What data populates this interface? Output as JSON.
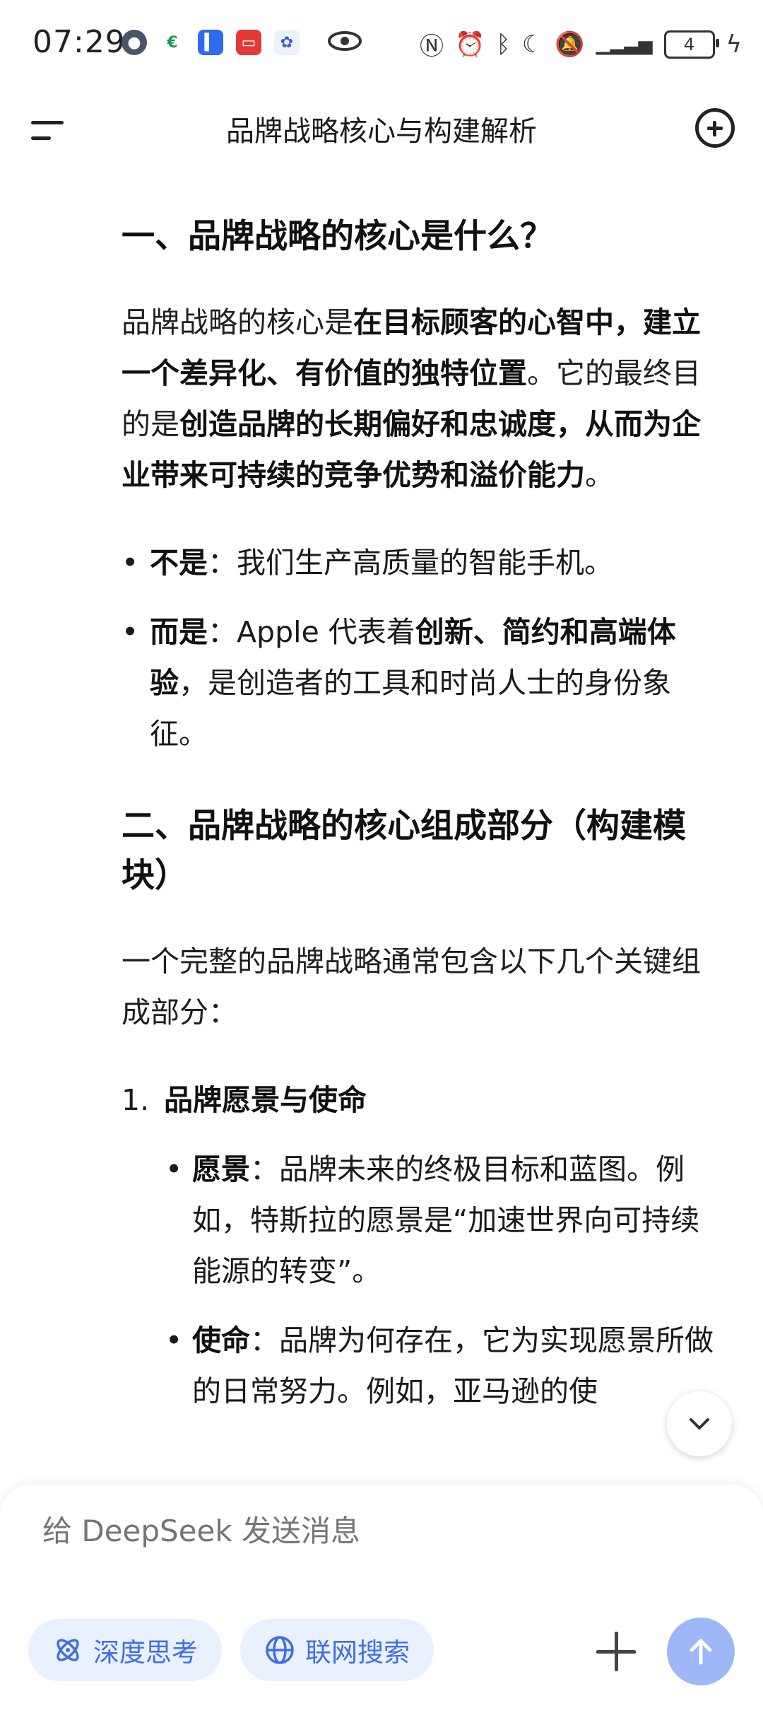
{
  "status_bar": {
    "time": "07:29",
    "battery": "4",
    "left_icons": [
      "avatar-icon",
      "payment-app-icon",
      "voice-app-icon",
      "red-app-icon",
      "baidu-app-icon",
      "eye-icon"
    ],
    "right_icons": [
      "nfc-icon",
      "alarm-icon",
      "bluetooth-icon",
      "moon-icon",
      "mute-icon",
      "signal-icon",
      "battery-icon",
      "charging-icon"
    ]
  },
  "header": {
    "title": "品牌战略核心与构建解析"
  },
  "content": {
    "section1_heading": "一、品牌战略的核心是什么？",
    "section1_para": {
      "t1": "品牌战略的核心是",
      "b1": "在目标顾客的心智中，建立一个差异化、有价值的独特位置",
      "t2": "。它的最终目的是",
      "b2": "创造品牌的长期偏好和忠诚度，从而为企业带来可持续的竞争优势和溢价能力",
      "t3": "。"
    },
    "bullet1": {
      "label": "不是",
      "text": "：我们生产高质量的智能手机。"
    },
    "bullet2": {
      "label": "而是",
      "t1": "：Apple 代表着",
      "b1": "创新、简约和高端体验",
      "t2": "，是创造者的工具和时尚人士的身份象征。"
    },
    "section2_heading": "二、品牌战略的核心组成部分（构建模块）",
    "section2_intro": "一个完整的品牌战略通常包含以下几个关键组成部分：",
    "item1": {
      "num": "1.",
      "title": "品牌愿景与使命"
    },
    "sub1": {
      "label": "愿景",
      "text": "：品牌未来的终极目标和蓝图。例如，特斯拉的愿景是“加速世界向可持续能源的转变”。"
    },
    "sub2": {
      "label": "使命",
      "text": "：品牌为何存在，它为实现愿景所做的日常努力。例如，亚马逊的使"
    }
  },
  "composer": {
    "placeholder": "给 DeepSeek 发送消息",
    "deep_think_label": "深度思考",
    "web_search_label": "联网搜索"
  },
  "colors": {
    "accent": "#3f6fe6",
    "chip_bg": "#e9f0fe",
    "send_bg": "#9db7f7",
    "placeholder": "#a5a8ad"
  }
}
